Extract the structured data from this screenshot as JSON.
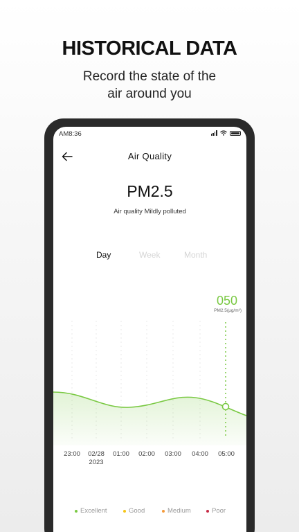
{
  "promo": {
    "title": "HISTORICAL DATA",
    "subtitle_line1": "Record the state of the",
    "subtitle_line2": "air around you"
  },
  "status_bar": {
    "time": "AM8:36"
  },
  "nav": {
    "back_icon": "arrow-left-icon",
    "title": "Air Quality"
  },
  "metric": {
    "name": "PM2.5",
    "status": "Air quality Mildly polluted"
  },
  "tabs": [
    {
      "label": "Day",
      "active": true
    },
    {
      "label": "Week",
      "active": false
    },
    {
      "label": "Month",
      "active": false
    }
  ],
  "reading": {
    "value": "050",
    "unit": "PM2.5(μg/m³)"
  },
  "colors": {
    "accent": "#7ac943",
    "excellent": "#7ac943",
    "good": "#f5c518",
    "medium": "#f39a3a",
    "poor": "#c62a45"
  },
  "chart_data": {
    "type": "area",
    "x": [
      "23:00",
      "02/28 2023",
      "01:00",
      "02:00",
      "03:00",
      "04:00",
      "05:00"
    ],
    "x_labels": [
      {
        "time": "23:00",
        "date": ""
      },
      {
        "time": "02/28",
        "date": "2023"
      },
      {
        "time": "01:00",
        "date": ""
      },
      {
        "time": "02:00",
        "date": ""
      },
      {
        "time": "03:00",
        "date": ""
      },
      {
        "time": "04:00",
        "date": ""
      },
      {
        "time": "05:00",
        "date": ""
      }
    ],
    "selected_index": 6,
    "selected_value": 50
  },
  "legend": [
    {
      "label": "Excellent",
      "color": "#7ac943"
    },
    {
      "label": "Good",
      "color": "#f5c518"
    },
    {
      "label": "Medium",
      "color": "#f39a3a"
    },
    {
      "label": "Poor",
      "color": "#c62a45"
    }
  ]
}
